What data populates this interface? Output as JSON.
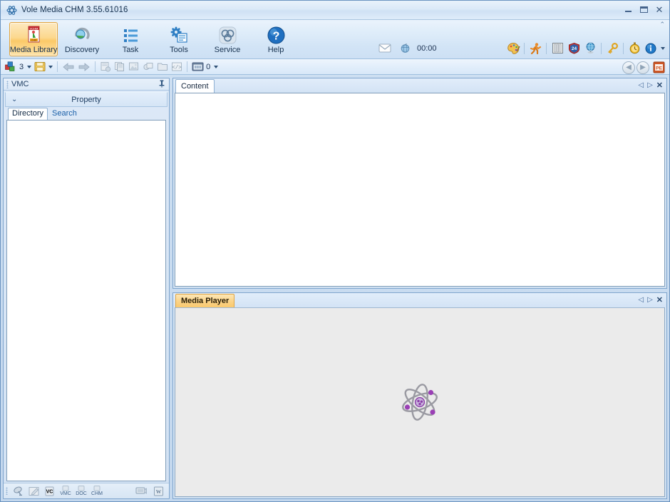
{
  "window": {
    "title": "Vole Media CHM  3.55.61016",
    "app_icon": "atom-icon",
    "minimize_label": "Minimize",
    "maximize_label": "Maximize",
    "close_label": "Close"
  },
  "ribbon": {
    "buttons": [
      {
        "label": "Media Library",
        "icon": "media-library-icon",
        "active": true
      },
      {
        "label": "Discovery",
        "icon": "discovery-icon",
        "active": false
      },
      {
        "label": "Task",
        "icon": "task-list-icon",
        "active": false
      },
      {
        "label": "Tools",
        "icon": "tools-gear-icon",
        "active": false
      },
      {
        "label": "Service",
        "icon": "service-atom-icon",
        "active": false
      },
      {
        "label": "Help",
        "icon": "help-question-icon",
        "active": false
      }
    ],
    "center": {
      "mail_icon": "envelope-icon",
      "clock_icon": "globe-clock-icon",
      "clock_value": "00:00"
    },
    "tools": [
      {
        "icon": "palette-icon",
        "label": "Palette"
      },
      {
        "icon": "running-figure-icon",
        "label": "Animation"
      },
      {
        "icon": "bookshelf-icon",
        "label": "Library"
      },
      {
        "icon": "road-sign-icon",
        "label": "Navigation"
      },
      {
        "icon": "globe-icon",
        "label": "Web"
      },
      {
        "icon": "key-icon",
        "label": "Key"
      },
      {
        "icon": "stopwatch-icon",
        "label": "Timer"
      },
      {
        "icon": "info-icon",
        "label": "About"
      }
    ],
    "pin_icon": "collapse-ribbon-icon"
  },
  "toolbar": {
    "items": [
      {
        "icon": "blocks-icon",
        "value": "3",
        "has_dropdown": true
      },
      {
        "icon": "save-disk-icon",
        "value": "",
        "has_dropdown": true
      },
      {
        "icon": "arrow-left-icon",
        "value": "",
        "has_dropdown": false
      },
      {
        "icon": "arrow-right-icon",
        "value": "",
        "has_dropdown": false
      },
      {
        "icon": "import-icon",
        "value": "",
        "has_dropdown": false
      },
      {
        "icon": "copy-pages-icon",
        "value": "",
        "has_dropdown": false
      },
      {
        "icon": "images-icon",
        "value": "",
        "has_dropdown": false
      },
      {
        "icon": "link-icon",
        "value": "",
        "has_dropdown": false
      },
      {
        "icon": "folder-icon",
        "value": "",
        "has_dropdown": false
      },
      {
        "icon": "code-icon",
        "value": "",
        "has_dropdown": false
      },
      {
        "icon": "album-icon",
        "value": "0",
        "has_dropdown": true
      }
    ],
    "nav_back_icon": "nav-back-icon",
    "nav_forward_icon": "nav-forward-icon",
    "pe_icon": "pe-document-icon"
  },
  "left_panel": {
    "caption": "VMC",
    "pin_icon": "auto-hide-pin-icon",
    "property_bar": {
      "chevron_icon": "chevron-down-double-icon",
      "label": "Property"
    },
    "tabs": [
      {
        "label": "Directory",
        "active": true
      },
      {
        "label": "Search",
        "active": false
      }
    ],
    "status_icons": [
      {
        "icon": "satellite-dish-icon",
        "label": ""
      },
      {
        "icon": "edit-page-icon",
        "label": ""
      },
      {
        "icon": "doc-badge-icon",
        "label": ""
      },
      {
        "icon": "vmc-file-icon",
        "label": "VMC"
      },
      {
        "icon": "doc-file-icon",
        "label": "DOC"
      },
      {
        "icon": "chm-file-icon",
        "label": "CHM"
      }
    ],
    "status_right_icons": [
      {
        "icon": "screen-icon",
        "label": ""
      },
      {
        "icon": "word-doc-icon",
        "label": ""
      }
    ]
  },
  "content_panel": {
    "tab_label": "Content",
    "nav_prev_icon": "tab-prev-icon",
    "nav_next_icon": "tab-next-icon",
    "close_icon": "panel-close-icon"
  },
  "player_panel": {
    "tab_label": "Media Player",
    "nav_prev_icon": "tab-prev-icon",
    "nav_next_icon": "tab-next-icon",
    "close_icon": "panel-close-icon",
    "placeholder_icon": "atom-logo-icon"
  },
  "colors": {
    "accent_blue": "#7fa5cd",
    "active_tab_amber": "#fbd48a",
    "ribbon_active": "#fcd88e",
    "panel_bg": "#d6e5f5",
    "content_white": "#ffffff",
    "player_gray": "#ebebeb",
    "atom_purple": "#8b3fa8",
    "title_text": "#16314f"
  }
}
